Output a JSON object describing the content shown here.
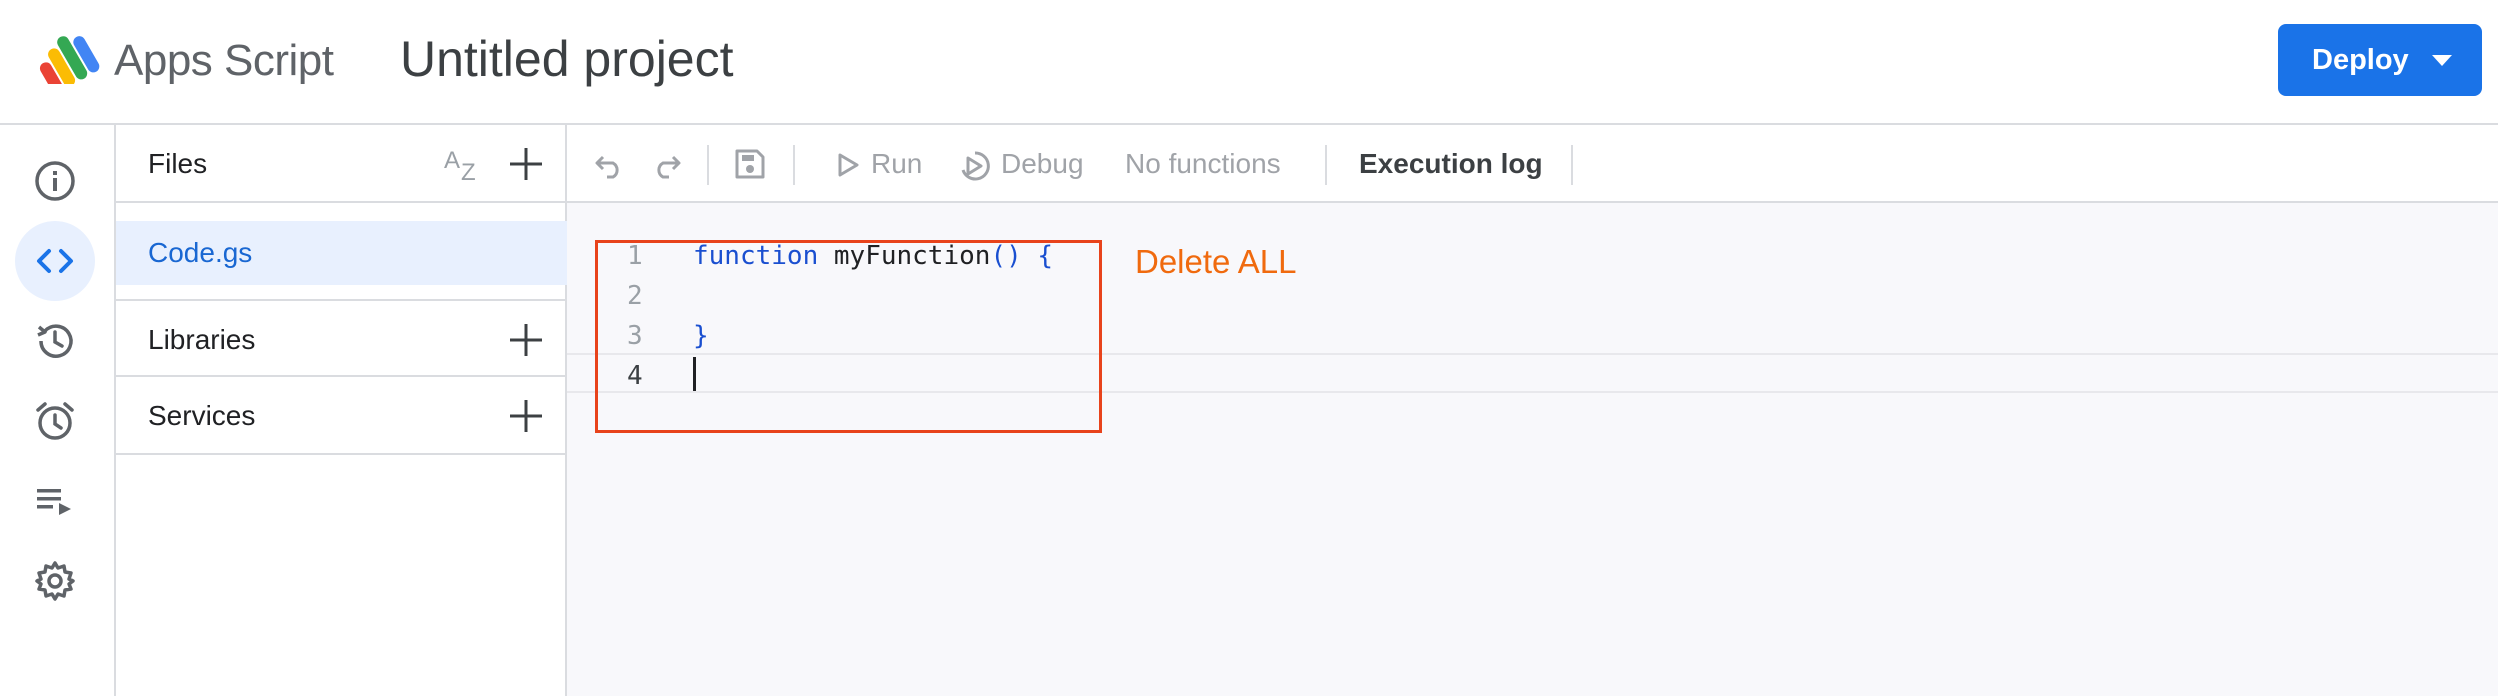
{
  "header": {
    "brand": "Apps Script",
    "project_title": "Untitled project",
    "deploy_label": "Deploy"
  },
  "rail": {
    "items": [
      "info-icon",
      "code-icon",
      "history-icon",
      "alarm-icon",
      "playlist-icon",
      "gear-icon"
    ],
    "active": "code-icon"
  },
  "files_panel": {
    "files_label": "Files",
    "file_name": "Code.gs",
    "libraries_label": "Libraries",
    "services_label": "Services"
  },
  "toolbar": {
    "run_label": "Run",
    "debug_label": "Debug",
    "function_select": "No functions",
    "execution_log_label": "Execution log"
  },
  "editor": {
    "line_numbers": [
      "1",
      "2",
      "3",
      "4"
    ],
    "line1_keyword": "function",
    "line1_name": "myFunction",
    "line1_punct": "() {",
    "line3_text": "}"
  },
  "annotation": {
    "note": "Delete ALL",
    "color": "#e8431b"
  },
  "colors": {
    "accent": "#1a73e8",
    "selected_bg": "#e8f0fe",
    "annotation_text": "#f06a0e"
  }
}
